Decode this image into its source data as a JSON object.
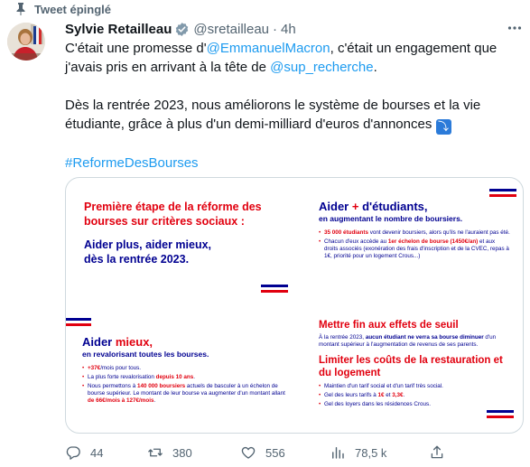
{
  "pinned_label": "Tweet épinglé",
  "author": {
    "name": "Sylvie Retailleau",
    "handle": "@sretailleau",
    "separator": "·",
    "time": "4h"
  },
  "icons": [
    "pin-icon",
    "verified-icon",
    "more-icon",
    "reply-icon",
    "retweet-icon",
    "like-icon",
    "views-icon",
    "share-icon"
  ],
  "colors": {
    "link": "#1d9bf0",
    "text": "#0f1419",
    "muted": "#536471",
    "verified": "#829aab",
    "flag_blue": "#000091",
    "flag_red": "#e1000f"
  },
  "tweet": {
    "line1_pre": "C'était une promesse d'",
    "mention1": "@EmmanuelMacron",
    "line1_post": ", c'était un engagement que j'avais pris en arrivant à la tête de ",
    "mention2": "@sup_recherche",
    "line1_end": ".",
    "para2": "Dès la rentrée 2023, nous améliorons le système de bourses et la vie étudiante, grâce à plus d'un demi-milliard d'euros d'annonces",
    "emoji": "⤵",
    "hashtag": "#ReformeDesBourses"
  },
  "media": {
    "panel1": {
      "title_red": "Première étape de la réforme des bourses sur critères sociaux :",
      "title_blue": "Aider plus, aider mieux, dès la rentrée 2023."
    },
    "panel2": {
      "title_a": "Aider",
      "title_plus": "+",
      "title_b": "d'étudiants,",
      "subtitle": "en augmentant le nombre de boursiers.",
      "b1_red": "35 000 étudiants",
      "b1_rest": " vont devenir boursiers, alors qu'ils ne l'auraient pas été.",
      "b2_pre": "Chacun d'eux accède au ",
      "b2_red": "1er échelon de bourse (1450€/an)",
      "b2_rest": " et aux droits associés (exonération des frais d'inscription et de la CVEC, repas à 1€, priorité pour un logement Crous...)"
    },
    "panel3": {
      "title_a": "Aider",
      "title_red": "mieux,",
      "subtitle": "en revalorisant toutes les bourses.",
      "b1_red": "+37€",
      "b1_rest": "/mois pour tous.",
      "b2_pre": "La plus forte revalorisation ",
      "b2_red": "depuis 10 ans",
      "b2_end": ".",
      "b3_pre": "Nous permettons à ",
      "b3_red": "140 000 boursiers",
      "b3_rest": " actuels de basculer à un échelon de bourse supérieur. Le montant de leur bourse va augmenter d'un montant allant ",
      "b3_red2": "de 66€/mois à 127€/mois",
      "b3_end": "."
    },
    "panel4": {
      "title1": "Mettre fin aux effets de seuil",
      "body1_pre": "À la rentrée 2023, ",
      "body1_bold": "aucun étudiant ne verra sa bourse diminuer",
      "body1_rest": " d'un montant supérieur à l'augmentation de revenus de ses parents.",
      "title2": "Limiter les coûts de la restauration et du logement",
      "b1": "Maintien d'un tarif social et d'un tarif très social.",
      "b2_pre": "Gel des leurs tarifs à ",
      "b2_red1": "1€",
      "b2_mid": " et ",
      "b2_red2": "3,3€",
      "b2_end": ".",
      "b3": "Gel des loyers dans les résidences Crous."
    }
  },
  "actions": {
    "replies": "44",
    "retweets": "380",
    "likes": "556",
    "views": "78,5 k"
  }
}
